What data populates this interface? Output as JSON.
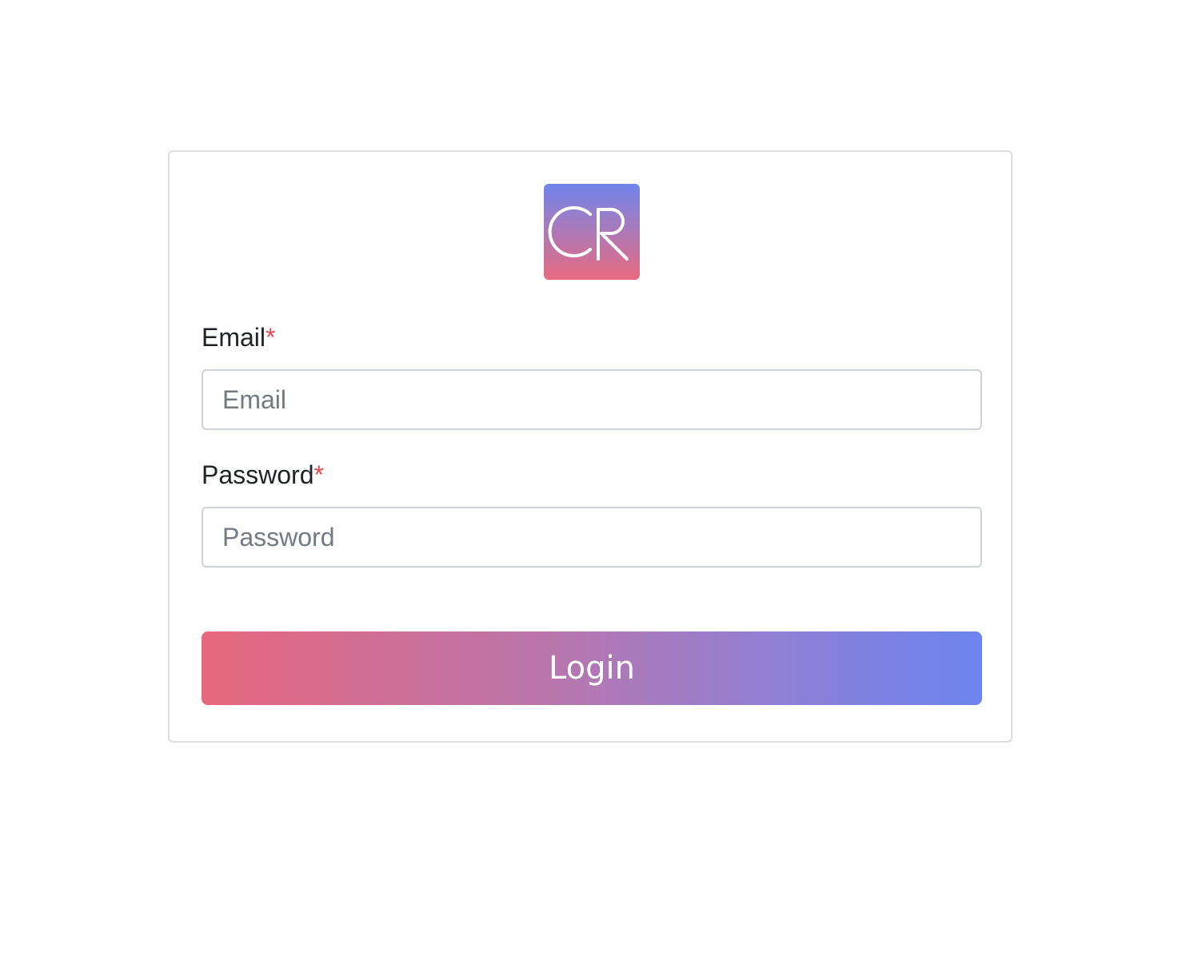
{
  "logo": {
    "text": "CR",
    "gradient_top": "#6f85ec",
    "gradient_bottom": "#e86a80"
  },
  "form": {
    "email": {
      "label": "Email",
      "required_mark": "*",
      "placeholder": "Email",
      "value": ""
    },
    "password": {
      "label": "Password",
      "required_mark": "*",
      "placeholder": "Password",
      "value": ""
    },
    "login_label": "Login"
  },
  "colors": {
    "required": "#e5484d",
    "button_gradient_start": "#e8687d",
    "button_gradient_end": "#6d84f0"
  }
}
